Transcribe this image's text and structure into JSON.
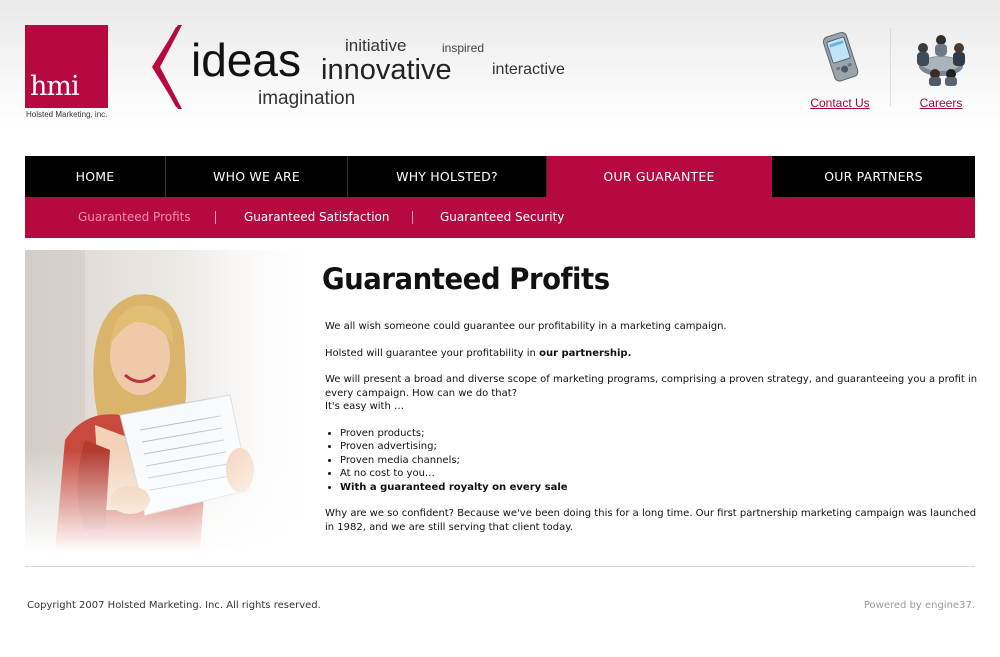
{
  "brand": {
    "logo_text": "hmi",
    "company_name": "Holsted Marketing, inc.",
    "accent_color": "#b5093f"
  },
  "tagline_words": {
    "ideas": "ideas",
    "initiative": "initiative",
    "inspired": "inspired",
    "innovative": "innovative",
    "interactive": "interactive",
    "imagination": "imagination"
  },
  "utility_links": {
    "contact": {
      "label": "Contact Us",
      "icon": "pda-phone-icon"
    },
    "careers": {
      "label": "Careers",
      "icon": "meeting-people-icon"
    }
  },
  "nav": {
    "items": [
      {
        "label": "HOME"
      },
      {
        "label": "WHO WE ARE"
      },
      {
        "label": "WHY HOLSTED?"
      },
      {
        "label": "OUR GUARANTEE",
        "active": true
      },
      {
        "label": "OUR PARTNERS"
      }
    ]
  },
  "subnav": {
    "items": [
      {
        "label": "Guaranteed Profits",
        "active": true
      },
      {
        "label": "Guaranteed Satisfaction"
      },
      {
        "label": "Guaranteed Security"
      }
    ]
  },
  "main": {
    "title": "Guaranteed Profits",
    "p1": "We all wish someone could guarantee our profitability in a marketing campaign.",
    "p2_prefix": "Holsted will guarantee your profitability in ",
    "p2_bold": "our partnership.",
    "p3_line1": "We will present a broad and diverse scope of marketing programs, comprising a proven strategy, and guaranteeing you a profit in every campaign.  How can we do that?",
    "p3_line2": "It's easy with …",
    "bullets": [
      "Proven products;",
      "Proven advertising;",
      "Proven media channels;",
      "At no cost to you…"
    ],
    "bullet_bold": "With a guaranteed royalty on every sale",
    "p4": "Why are we so confident?  Because we've been doing this for a long time.  Our first partnership marketing campaign was launched in 1982, and we are still serving that client today."
  },
  "footer": {
    "copyright": "Copyright 2007 Holsted Marketing. Inc. All rights reserved.",
    "powered": "Powered by engine37."
  }
}
